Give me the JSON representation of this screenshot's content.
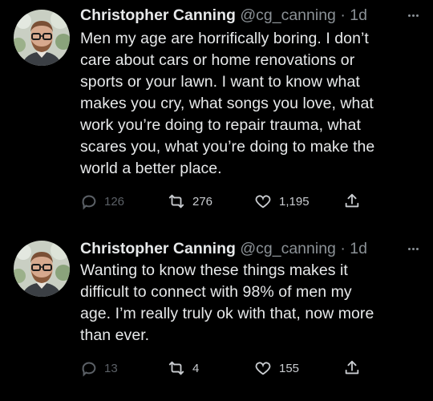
{
  "tweets": [
    {
      "author": {
        "name": "Christopher Canning",
        "handle": "@cg_canning",
        "separator": "·",
        "time": "1d"
      },
      "text_lines": [
        "Men my age are horrifically boring. I don’t",
        "care about cars or home renovations or",
        "sports or your lawn. I want to know what",
        "makes you cry, what songs you love, what",
        "work you’re doing to repair trauma, what",
        "scares you, what you’re doing to make the",
        "world a better place."
      ],
      "stats": {
        "replies": "126",
        "retweets": "276",
        "likes": "1,195"
      }
    },
    {
      "author": {
        "name": "Christopher Canning",
        "handle": "@cg_canning",
        "separator": "·",
        "time": "1d"
      },
      "text_lines": [
        "Wanting to know these things makes it",
        "difficult to connect with 98% of men my",
        "age. I’m really truly ok with that, now more",
        "than ever."
      ],
      "stats": {
        "replies": "13",
        "retweets": "4",
        "likes": "155"
      }
    }
  ],
  "icons": {
    "reply": "reply-icon",
    "retweet": "retweet-icon",
    "like": "heart-icon",
    "share": "share-icon",
    "more": "more-dots-icon"
  },
  "colors": {
    "background": "#000000",
    "text": "#e7e9ea",
    "secondary": "#8b9196",
    "muted": "#5b6066"
  }
}
